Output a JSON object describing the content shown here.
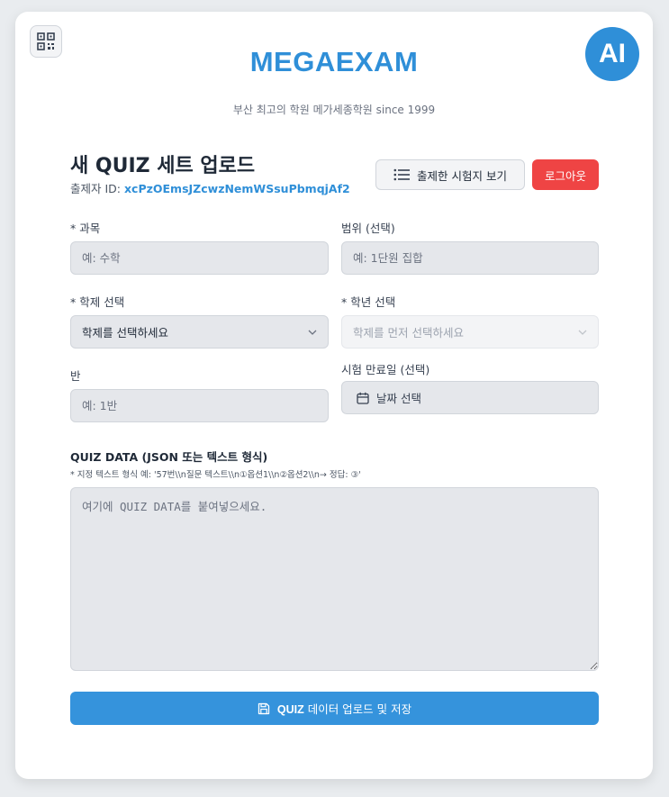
{
  "header": {
    "brand": "MEGAEXAM",
    "ai_badge": "AI",
    "tagline": "부산 최고의 학원 메가세종학원 since 1999"
  },
  "form": {
    "title": "새 QUIZ 세트 업로드",
    "author_prefix": "출제자 ID: ",
    "author_id": "xcPzOEmsJZcwzNemWSsuPbmqjAf2",
    "view_button": "출제한 시험지 보기",
    "logout_button": "로그아웃"
  },
  "fields": {
    "subject": {
      "label": "* 과목",
      "placeholder": "예: 수학"
    },
    "range": {
      "label": "범위 (선택)",
      "placeholder": "예: 1단원 집합"
    },
    "school_type": {
      "label": "* 학제 선택",
      "value": "학제를 선택하세요"
    },
    "grade": {
      "label": "* 학년 선택",
      "value": "학제를 먼저 선택하세요"
    },
    "class": {
      "label": "반",
      "placeholder": "예: 1반"
    },
    "due_date": {
      "label": "시험 만료일 (선택)",
      "value": "날짜 선택"
    }
  },
  "quiz": {
    "label": "QUIZ DATA (JSON 또는 텍스트 형식)",
    "hint": "* 지정 텍스트 형식 예: '57번\\\\n질문 텍스트\\\\n①옵션1\\\\n②옵션2\\\\n→ 정답: ③'",
    "placeholder": "여기에 QUIZ DATA를 붙여넣으세요."
  },
  "submit": {
    "bold": "QUIZ",
    "rest": "데이터 업로드 및 저장"
  },
  "colors": {
    "accent": "#2f8fd8",
    "danger": "#ef4444",
    "field_bg": "#e5e7eb"
  },
  "icons": [
    "qr-code-icon",
    "list-icon",
    "chevron-down-icon",
    "calendar-icon",
    "save-icon"
  ]
}
